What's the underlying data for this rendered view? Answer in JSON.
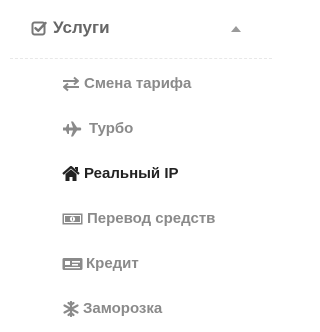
{
  "section": {
    "label": "Услуги",
    "icon": "check-square-icon",
    "toggle_icon": "caret-up-icon",
    "expanded": true
  },
  "items": [
    {
      "label": "Смена тарифа",
      "icon": "exchange-arrows-icon",
      "active": false
    },
    {
      "label": "Турбо",
      "icon": "airplane-icon",
      "active": false
    },
    {
      "label": "Реальный IP",
      "icon": "home-icon",
      "active": true
    },
    {
      "label": "Перевод средств",
      "icon": "money-bill-icon",
      "active": false
    },
    {
      "label": "Кредит",
      "icon": "credit-card-icon",
      "active": false
    },
    {
      "label": "Заморозка",
      "icon": "snowflake-icon",
      "active": false
    }
  ],
  "colors": {
    "item_text": "#8a8a8a",
    "item_text_active": "#222222",
    "section_text": "#666666",
    "divider": "#e8e8e8"
  }
}
